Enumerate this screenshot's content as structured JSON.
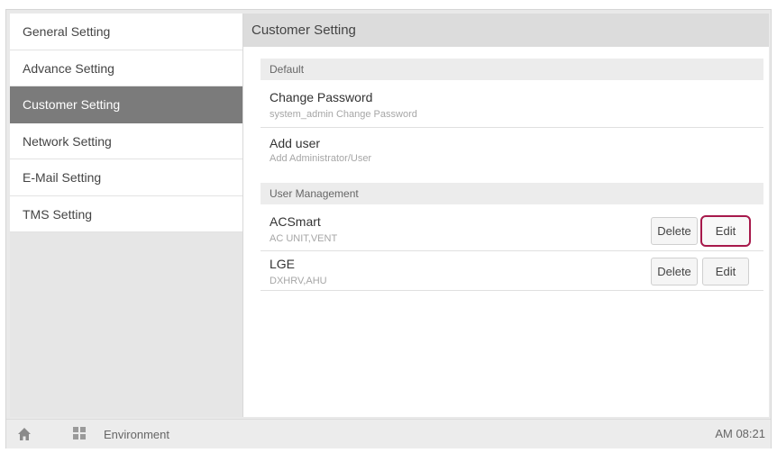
{
  "sidebar": {
    "items": [
      {
        "label": "General Setting"
      },
      {
        "label": "Advance Setting"
      },
      {
        "label": "Customer Setting"
      },
      {
        "label": "Network Setting"
      },
      {
        "label": "E-Mail Setting"
      },
      {
        "label": "TMS Setting"
      }
    ],
    "active_index": 2
  },
  "main": {
    "title": "Customer Setting",
    "default_section": {
      "header": "Default",
      "items": [
        {
          "title": "Change Password",
          "subtitle": "system_admin Change Password"
        },
        {
          "title": "Add user",
          "subtitle": "Add Administrator/User"
        }
      ]
    },
    "user_section": {
      "header": "User Management",
      "users": [
        {
          "name": "ACSmart",
          "detail": "AC UNIT,VENT",
          "delete_label": "Delete",
          "edit_label": "Edit"
        },
        {
          "name": "LGE",
          "detail": "DXHRV,AHU",
          "delete_label": "Delete",
          "edit_label": "Edit"
        }
      ]
    }
  },
  "bottom_bar": {
    "icons": [
      "home-icon",
      "grid-icon"
    ],
    "label": "Environment",
    "clock": "AM 08:21"
  },
  "colors": {
    "active_sidebar": "#7b7b7b",
    "focus_border": "#a7194b",
    "header_bg": "#dcdcdc"
  }
}
